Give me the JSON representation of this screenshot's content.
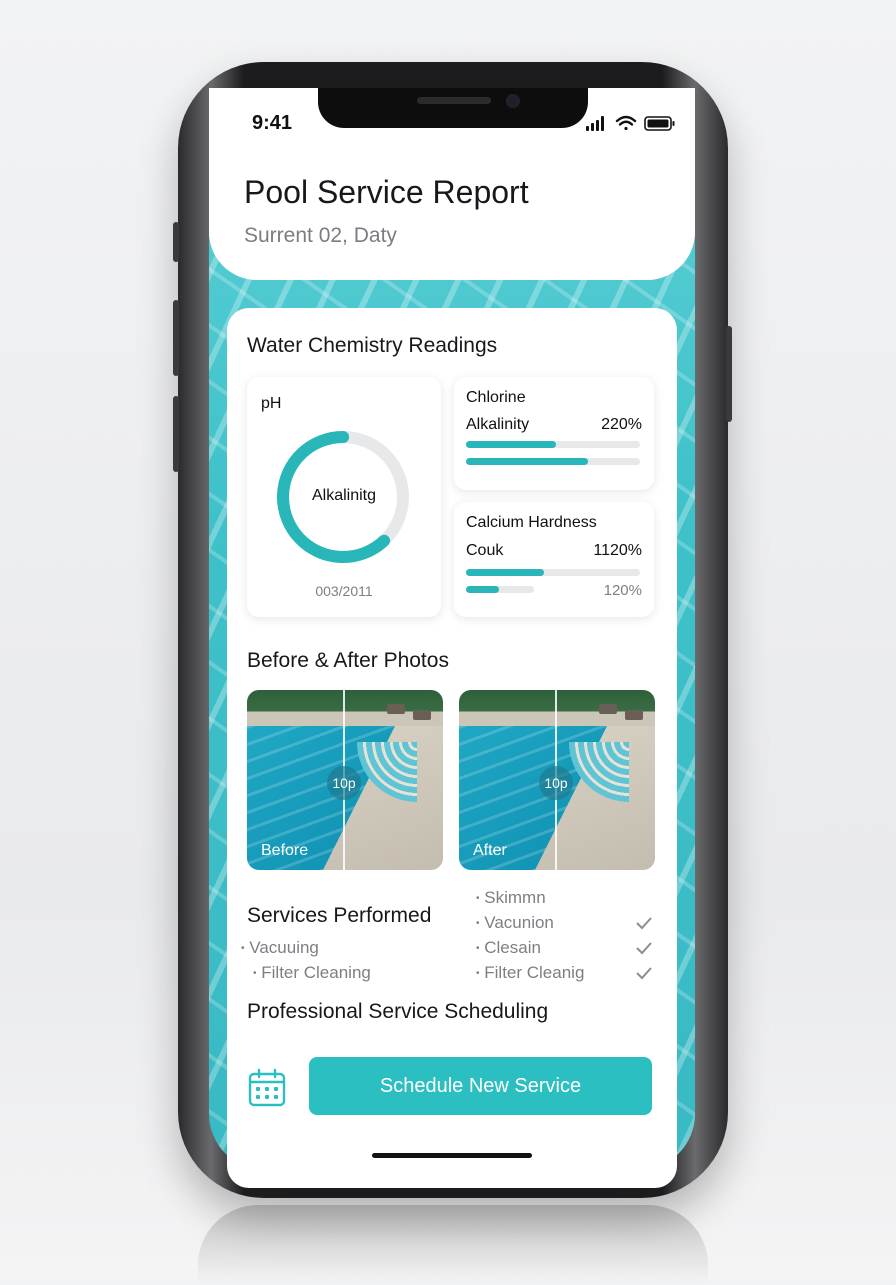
{
  "status_bar": {
    "time": "9:41"
  },
  "header": {
    "title": "Pool Service Report",
    "subtitle": "Surrent 02, Daty"
  },
  "chemistry": {
    "section_title": "Water Chemistry Readings",
    "ph_card": {
      "label": "pH",
      "gauge_label": "Alkalinitg",
      "gauge_fraction": 0.62,
      "footer": "003/2011"
    },
    "chlorine_card": {
      "title": "Chlorine",
      "row_label": "Alkalinity",
      "row_value": "220%",
      "bars": [
        0.52,
        0.7
      ]
    },
    "calcium_card": {
      "title": "Calcium Hardness",
      "row_label": "Couk",
      "row_value": "1120%",
      "bar1": 0.45,
      "bar2": 0.48,
      "bar2_value": "120%"
    }
  },
  "photos": {
    "section_title": "Before & After Photos",
    "before": {
      "label": "Before",
      "zoom": "10p"
    },
    "after": {
      "label": "After",
      "zoom": "10p"
    }
  },
  "services": {
    "section_title": "Services Performed",
    "left_items": [
      "Vacuuing",
      "Filter Cleaning"
    ],
    "right_items": [
      "Skimmn",
      "Vacunion",
      "Clesain",
      "Filter Cleanig"
    ]
  },
  "scheduling": {
    "section_title": "Professional Service Scheduling",
    "button_label": "Schedule New Service"
  },
  "colors": {
    "accent": "#2bbfc1",
    "bar_fill": "#29b6b8",
    "track": "#e6e8ea"
  }
}
